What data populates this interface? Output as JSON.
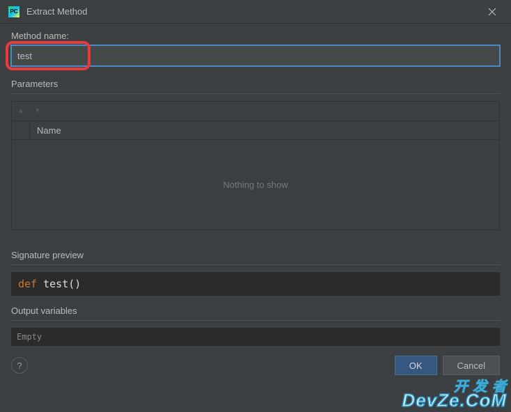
{
  "window": {
    "title": "Extract Method"
  },
  "method_name": {
    "label": "Method name:",
    "value": "test"
  },
  "parameters": {
    "label": "Parameters",
    "column_name": "Name",
    "empty_text": "Nothing to show"
  },
  "signature": {
    "label": "Signature preview",
    "keyword": "def",
    "name": "test",
    "parens": "()"
  },
  "output_vars": {
    "label": "Output variables",
    "value": "Empty"
  },
  "buttons": {
    "ok": "OK",
    "cancel": "Cancel",
    "help": "?"
  },
  "watermark": {
    "line1": "开 发 者",
    "line2": "DevZe.CoM"
  }
}
